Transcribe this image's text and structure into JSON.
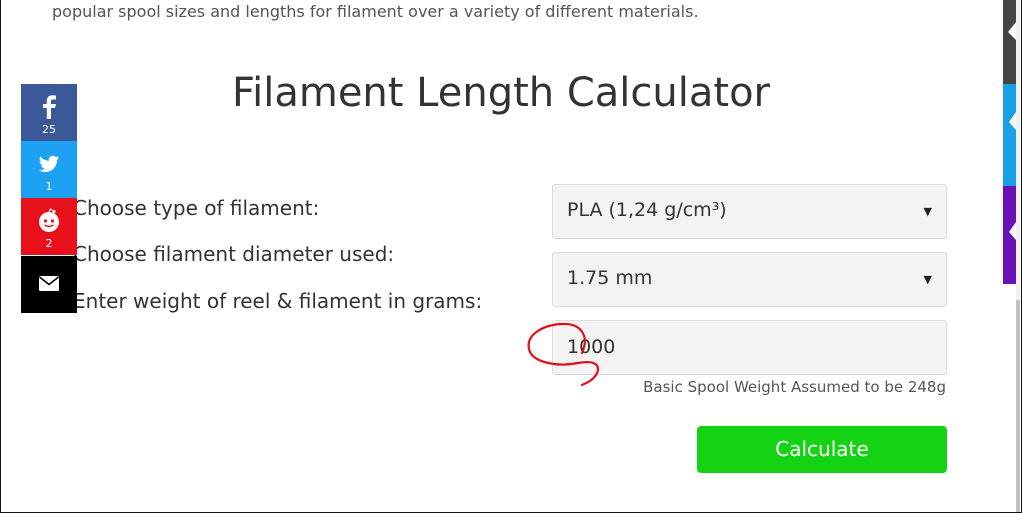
{
  "intro_text": "popular spool sizes and lengths for filament over a variety of different materials.",
  "title": "Filament Length Calculator",
  "form": {
    "filament_type_label": "Choose type of filament:",
    "filament_type_value": "PLA (1,24 g/cm³)",
    "diameter_label": "Choose filament diameter used:",
    "diameter_value": "1.75 mm",
    "weight_label": "Enter weight of reel & filament in grams:",
    "weight_value": "1000",
    "spool_hint": "Basic Spool Weight Assumed to be 248g",
    "calculate_label": "Calculate"
  },
  "share": {
    "facebook_count": "25",
    "twitter_count": "1",
    "reddit_count": "2"
  },
  "icons": {
    "facebook": "facebook-icon",
    "twitter": "twitter-icon",
    "reddit": "reddit-icon",
    "email": "email-icon",
    "caret": "caret-down-icon"
  },
  "colors": {
    "facebook": "#3b5998",
    "twitter": "#1da1f2",
    "reddit": "#e8101a",
    "email": "#000000",
    "calculate_button": "#14d314",
    "annotation": "#e0101a",
    "side_tab_dark": "#444444",
    "side_tab_blue": "#1aa0e6",
    "side_tab_purple": "#6a11b5"
  }
}
